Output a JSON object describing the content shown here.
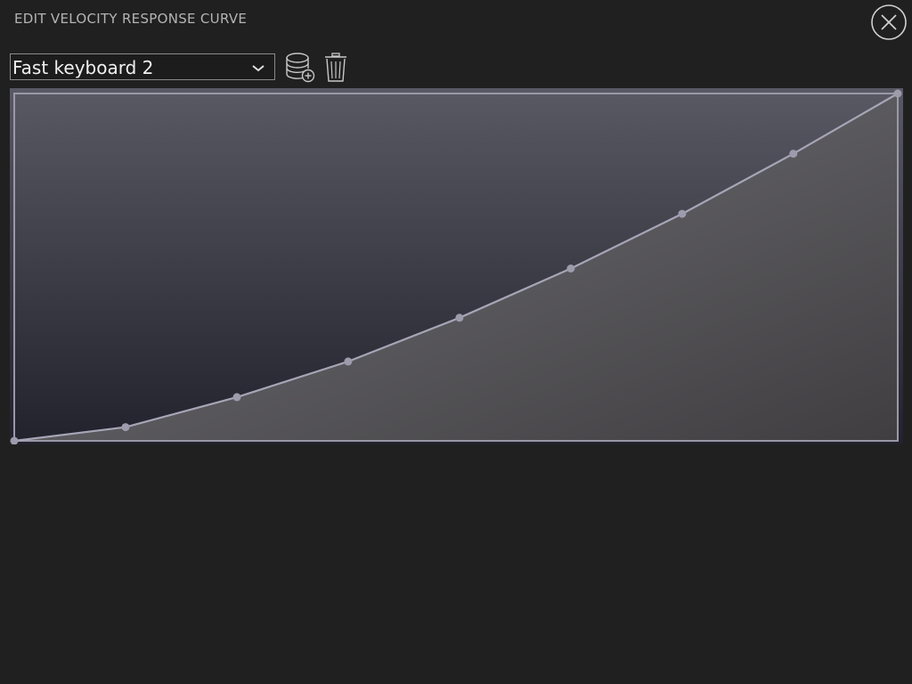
{
  "dialog": {
    "title": "EDIT VELOCITY RESPONSE CURVE"
  },
  "preset": {
    "selected": "Fast keyboard 2"
  },
  "colors": {
    "background": "#202020",
    "curve_line": "#a7a5b6",
    "curve_point": "#9d9bac",
    "title_text": "#b4b4b4",
    "icon": "#c8c8c8"
  },
  "curve": {
    "input_range": [
      0,
      127
    ],
    "output_range": [
      0,
      127
    ],
    "points": [
      {
        "in": 0,
        "out": 0
      },
      {
        "in": 16,
        "out": 5
      },
      {
        "in": 32,
        "out": 16
      },
      {
        "in": 48,
        "out": 29
      },
      {
        "in": 64,
        "out": 45
      },
      {
        "in": 80,
        "out": 63
      },
      {
        "in": 96,
        "out": 83
      },
      {
        "in": 112,
        "out": 105
      },
      {
        "in": 127,
        "out": 127
      }
    ]
  }
}
